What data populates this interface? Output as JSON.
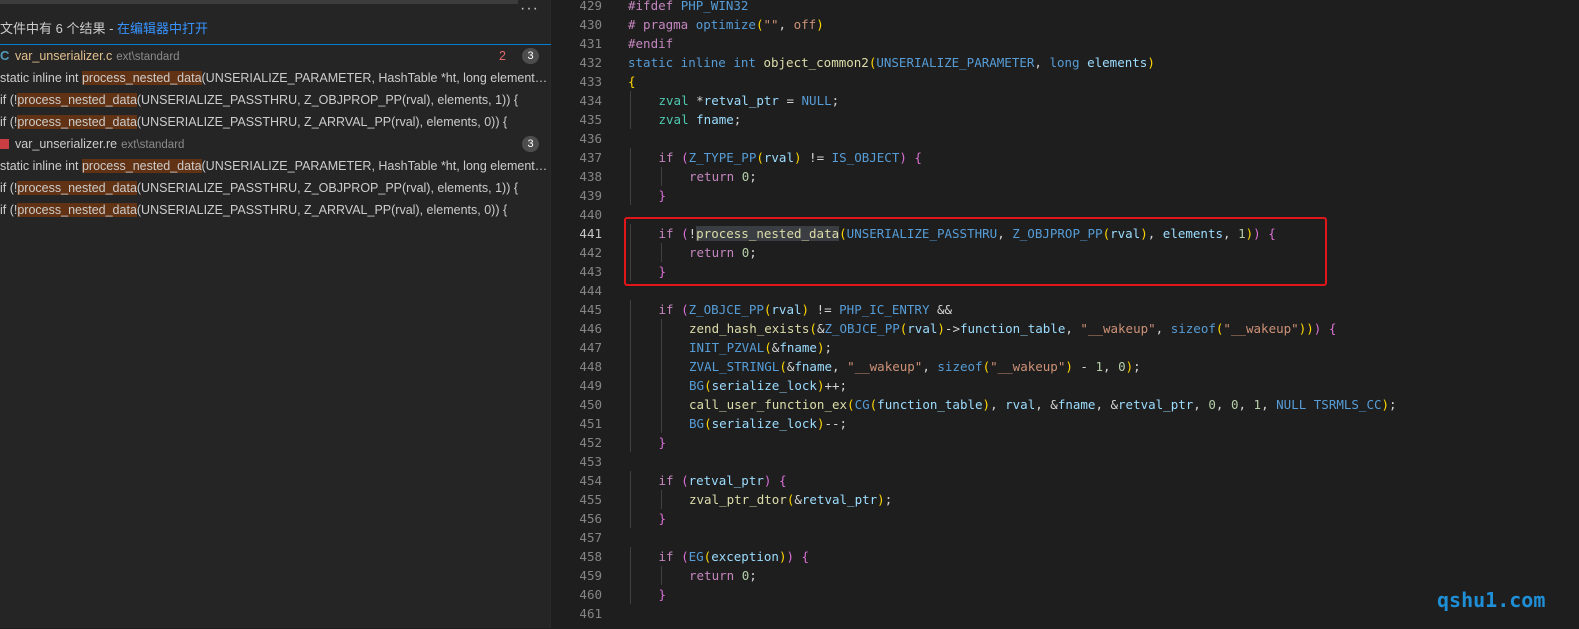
{
  "search": {
    "summary_prefix": "文件中有 6 个结果 - ",
    "summary_link": "在编辑器中打开",
    "more_label": "···",
    "files": [
      {
        "icon_label": "C",
        "icon": "c-file-icon",
        "name": "var_unserializer.c",
        "path": "ext\\standard",
        "problems": "2",
        "count": "3",
        "matches": [
          {
            "before": "static inline int ",
            "hit": "process_nested_data",
            "after": "(UNSERIALIZE_PARAMETER, HashTable *ht, long elements, i..."
          },
          {
            "before": "if (!",
            "hit": "process_nested_data",
            "after": "(UNSERIALIZE_PASSTHRU, Z_OBJPROP_PP(rval), elements, 1)) {"
          },
          {
            "before": "if (!",
            "hit": "process_nested_data",
            "after": "(UNSERIALIZE_PASSTHRU, Z_ARRVAL_PP(rval), elements, 0)) {"
          }
        ]
      },
      {
        "icon_label": "",
        "icon": "re-file-icon",
        "name": "var_unserializer.re",
        "path": "ext\\standard",
        "problems": "",
        "count": "3",
        "matches": [
          {
            "before": "static inline int ",
            "hit": "process_nested_data",
            "after": "(UNSERIALIZE_PARAMETER, HashTable *ht, long elements, i..."
          },
          {
            "before": "if (!",
            "hit": "process_nested_data",
            "after": "(UNSERIALIZE_PASSTHRU, Z_OBJPROP_PP(rval), elements, 1)) {"
          },
          {
            "before": "if (!",
            "hit": "process_nested_data",
            "after": "(UNSERIALIZE_PASSTHRU, Z_ARRVAL_PP(rval), elements, 0)) {"
          }
        ]
      }
    ]
  },
  "editor": {
    "active_line": "441",
    "lines": [
      {
        "n": "429",
        "i": 0,
        "t": [
          [
            "c",
            "#ifdef "
          ],
          [
            "k",
            "PHP_WIN32"
          ]
        ]
      },
      {
        "n": "430",
        "i": 0,
        "t": [
          [
            "c",
            "# pragma "
          ],
          [
            "k",
            "optimize"
          ],
          [
            "y",
            "("
          ],
          [
            "s",
            "\"\""
          ],
          [
            "w",
            ", "
          ],
          [
            "s",
            "off"
          ],
          [
            "y",
            ")"
          ]
        ]
      },
      {
        "n": "431",
        "i": 0,
        "t": [
          [
            "c",
            "#endif"
          ]
        ]
      },
      {
        "n": "432",
        "i": 0,
        "t": [
          [
            "k",
            "static inline int "
          ],
          [
            "f",
            "object_common2"
          ],
          [
            "y",
            "("
          ],
          [
            "k",
            "UNSERIALIZE_PARAMETER"
          ],
          [
            "w",
            ", "
          ],
          [
            "k",
            "long "
          ],
          [
            "v",
            "elements"
          ],
          [
            "y",
            ")"
          ]
        ]
      },
      {
        "n": "433",
        "i": 0,
        "t": [
          [
            "y",
            "{"
          ]
        ]
      },
      {
        "n": "434",
        "i": 1,
        "t": [
          [
            "m",
            "zval "
          ],
          [
            "w",
            "*"
          ],
          [
            "v",
            "retval_ptr"
          ],
          [
            "w",
            " = "
          ],
          [
            "k",
            "NULL"
          ],
          [
            "w",
            ";"
          ]
        ]
      },
      {
        "n": "435",
        "i": 1,
        "t": [
          [
            "m",
            "zval "
          ],
          [
            "v",
            "fname"
          ],
          [
            "w",
            ";"
          ]
        ]
      },
      {
        "n": "436",
        "i": 0,
        "t": []
      },
      {
        "n": "437",
        "i": 1,
        "t": [
          [
            "c",
            "if "
          ],
          [
            "p",
            "("
          ],
          [
            "k",
            "Z_TYPE_PP"
          ],
          [
            "y",
            "("
          ],
          [
            "v",
            "rval"
          ],
          [
            "y",
            ")"
          ],
          [
            "w",
            " != "
          ],
          [
            "k",
            "IS_OBJECT"
          ],
          [
            "p",
            ")"
          ],
          [
            "w",
            " "
          ],
          [
            "p",
            "{"
          ]
        ]
      },
      {
        "n": "438",
        "i": 2,
        "t": [
          [
            "c",
            "return "
          ],
          [
            "n",
            "0"
          ],
          [
            "w",
            ";"
          ]
        ]
      },
      {
        "n": "439",
        "i": 1,
        "t": [
          [
            "p",
            "}"
          ]
        ]
      },
      {
        "n": "440",
        "i": 0,
        "t": []
      },
      {
        "n": "441",
        "i": 1,
        "t": [
          [
            "c",
            "if "
          ],
          [
            "p",
            "("
          ],
          [
            "w",
            "!"
          ],
          [
            "fsel",
            "process_nested_data"
          ],
          [
            "y",
            "("
          ],
          [
            "k",
            "UNSERIALIZE_PASSTHRU"
          ],
          [
            "w",
            ", "
          ],
          [
            "k",
            "Z_OBJPROP_PP"
          ],
          [
            "y",
            "("
          ],
          [
            "v",
            "rval"
          ],
          [
            "y",
            ")"
          ],
          [
            "w",
            ", "
          ],
          [
            "v",
            "elements"
          ],
          [
            "w",
            ", "
          ],
          [
            "n",
            "1"
          ],
          [
            "y",
            ")"
          ],
          [
            "p",
            ")"
          ],
          [
            "w",
            " "
          ],
          [
            "p",
            "{"
          ]
        ]
      },
      {
        "n": "442",
        "i": 2,
        "t": [
          [
            "c",
            "return "
          ],
          [
            "n",
            "0"
          ],
          [
            "w",
            ";"
          ]
        ]
      },
      {
        "n": "443",
        "i": 1,
        "t": [
          [
            "p",
            "}"
          ]
        ]
      },
      {
        "n": "444",
        "i": 0,
        "t": []
      },
      {
        "n": "445",
        "i": 1,
        "t": [
          [
            "c",
            "if "
          ],
          [
            "p",
            "("
          ],
          [
            "k",
            "Z_OBJCE_PP"
          ],
          [
            "y",
            "("
          ],
          [
            "v",
            "rval"
          ],
          [
            "y",
            ")"
          ],
          [
            "w",
            " != "
          ],
          [
            "k",
            "PHP_IC_ENTRY"
          ],
          [
            "w",
            " &&"
          ]
        ]
      },
      {
        "n": "446",
        "i": 2,
        "t": [
          [
            "f",
            "zend_hash_exists"
          ],
          [
            "y",
            "("
          ],
          [
            "w",
            "&"
          ],
          [
            "k",
            "Z_OBJCE_PP"
          ],
          [
            "y",
            "("
          ],
          [
            "v",
            "rval"
          ],
          [
            "y",
            ")"
          ],
          [
            "w",
            "->"
          ],
          [
            "v",
            "function_table"
          ],
          [
            "w",
            ", "
          ],
          [
            "s",
            "\"__wakeup\""
          ],
          [
            "w",
            ", "
          ],
          [
            "k",
            "sizeof"
          ],
          [
            "y",
            "("
          ],
          [
            "s",
            "\"__wakeup\""
          ],
          [
            "y",
            ")"
          ],
          [
            "y",
            ")"
          ],
          [
            "p",
            ")"
          ],
          [
            "w",
            " "
          ],
          [
            "p",
            "{"
          ]
        ]
      },
      {
        "n": "447",
        "i": 2,
        "t": [
          [
            "k",
            "INIT_PZVAL"
          ],
          [
            "y",
            "("
          ],
          [
            "w",
            "&"
          ],
          [
            "v",
            "fname"
          ],
          [
            "y",
            ")"
          ],
          [
            "w",
            ";"
          ]
        ]
      },
      {
        "n": "448",
        "i": 2,
        "t": [
          [
            "k",
            "ZVAL_STRINGL"
          ],
          [
            "y",
            "("
          ],
          [
            "w",
            "&"
          ],
          [
            "v",
            "fname"
          ],
          [
            "w",
            ", "
          ],
          [
            "s",
            "\"__wakeup\""
          ],
          [
            "w",
            ", "
          ],
          [
            "k",
            "sizeof"
          ],
          [
            "y",
            "("
          ],
          [
            "s",
            "\"__wakeup\""
          ],
          [
            "y",
            ")"
          ],
          [
            "w",
            " - "
          ],
          [
            "n",
            "1"
          ],
          [
            "w",
            ", "
          ],
          [
            "n",
            "0"
          ],
          [
            "y",
            ")"
          ],
          [
            "w",
            ";"
          ]
        ]
      },
      {
        "n": "449",
        "i": 2,
        "t": [
          [
            "k",
            "BG"
          ],
          [
            "y",
            "("
          ],
          [
            "v",
            "serialize_lock"
          ],
          [
            "y",
            ")"
          ],
          [
            "w",
            "++;"
          ]
        ]
      },
      {
        "n": "450",
        "i": 2,
        "t": [
          [
            "f",
            "call_user_function_ex"
          ],
          [
            "y",
            "("
          ],
          [
            "k",
            "CG"
          ],
          [
            "y",
            "("
          ],
          [
            "v",
            "function_table"
          ],
          [
            "y",
            ")"
          ],
          [
            "w",
            ", "
          ],
          [
            "v",
            "rval"
          ],
          [
            "w",
            ", &"
          ],
          [
            "v",
            "fname"
          ],
          [
            "w",
            ", &"
          ],
          [
            "v",
            "retval_ptr"
          ],
          [
            "w",
            ", "
          ],
          [
            "n",
            "0"
          ],
          [
            "w",
            ", "
          ],
          [
            "n",
            "0"
          ],
          [
            "w",
            ", "
          ],
          [
            "n",
            "1"
          ],
          [
            "w",
            ", "
          ],
          [
            "k",
            "NULL TSRMLS_CC"
          ],
          [
            "y",
            ")"
          ],
          [
            "w",
            ";"
          ]
        ]
      },
      {
        "n": "451",
        "i": 2,
        "t": [
          [
            "k",
            "BG"
          ],
          [
            "y",
            "("
          ],
          [
            "v",
            "serialize_lock"
          ],
          [
            "y",
            ")"
          ],
          [
            "w",
            "--;"
          ]
        ]
      },
      {
        "n": "452",
        "i": 1,
        "t": [
          [
            "p",
            "}"
          ]
        ]
      },
      {
        "n": "453",
        "i": 0,
        "t": []
      },
      {
        "n": "454",
        "i": 1,
        "t": [
          [
            "c",
            "if "
          ],
          [
            "p",
            "("
          ],
          [
            "v",
            "retval_ptr"
          ],
          [
            "p",
            ")"
          ],
          [
            "w",
            " "
          ],
          [
            "p",
            "{"
          ]
        ]
      },
      {
        "n": "455",
        "i": 2,
        "t": [
          [
            "f",
            "zval_ptr_dtor"
          ],
          [
            "y",
            "("
          ],
          [
            "w",
            "&"
          ],
          [
            "v",
            "retval_ptr"
          ],
          [
            "y",
            ")"
          ],
          [
            "w",
            ";"
          ]
        ]
      },
      {
        "n": "456",
        "i": 1,
        "t": [
          [
            "p",
            "}"
          ]
        ]
      },
      {
        "n": "457",
        "i": 0,
        "t": []
      },
      {
        "n": "458",
        "i": 1,
        "t": [
          [
            "c",
            "if "
          ],
          [
            "p",
            "("
          ],
          [
            "k",
            "EG"
          ],
          [
            "y",
            "("
          ],
          [
            "v",
            "exception"
          ],
          [
            "y",
            ")"
          ],
          [
            "p",
            ")"
          ],
          [
            "w",
            " "
          ],
          [
            "p",
            "{"
          ]
        ]
      },
      {
        "n": "459",
        "i": 2,
        "t": [
          [
            "c",
            "return "
          ],
          [
            "n",
            "0"
          ],
          [
            "w",
            ";"
          ]
        ]
      },
      {
        "n": "460",
        "i": 1,
        "t": [
          [
            "p",
            "}"
          ]
        ]
      },
      {
        "n": "461",
        "i": 0,
        "t": []
      }
    ]
  },
  "watermark": "qshu1.com"
}
